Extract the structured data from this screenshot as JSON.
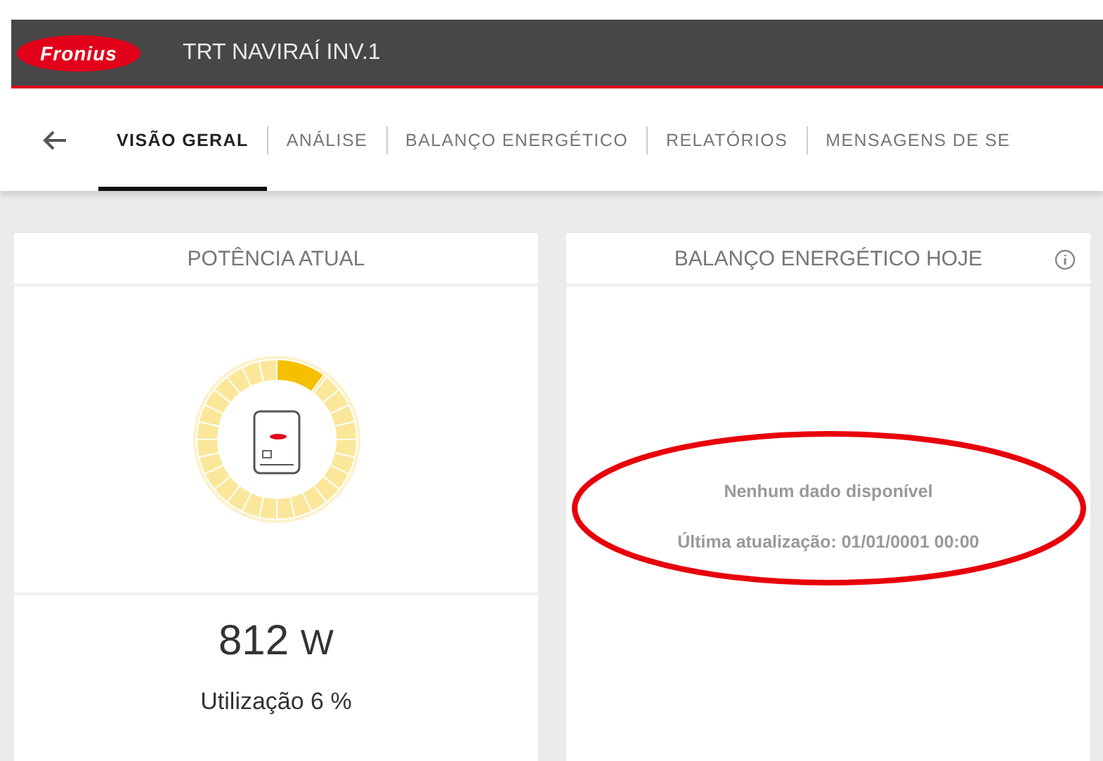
{
  "header": {
    "logo": "Fronius",
    "title": "TRT NAVIRAÍ INV.1"
  },
  "tabs": [
    {
      "label": "VISÃO GERAL",
      "selected": true
    },
    {
      "label": "ANÁLISE",
      "selected": false
    },
    {
      "label": "BALANÇO ENERGÉTICO",
      "selected": false
    },
    {
      "label": "RELATÓRIOS",
      "selected": false
    },
    {
      "label": "MENSAGENS DE SE",
      "selected": false
    }
  ],
  "power_card": {
    "title": "POTÊNCIA ATUAL",
    "value": "812",
    "unit": "W",
    "utilization": "Utilização 6 %"
  },
  "balance_card": {
    "title": "BALANÇO ENERGÉTICO HOJE",
    "message": "Nenhum dado disponível",
    "last_update": "Última atualização: 01/01/0001 00:00"
  }
}
